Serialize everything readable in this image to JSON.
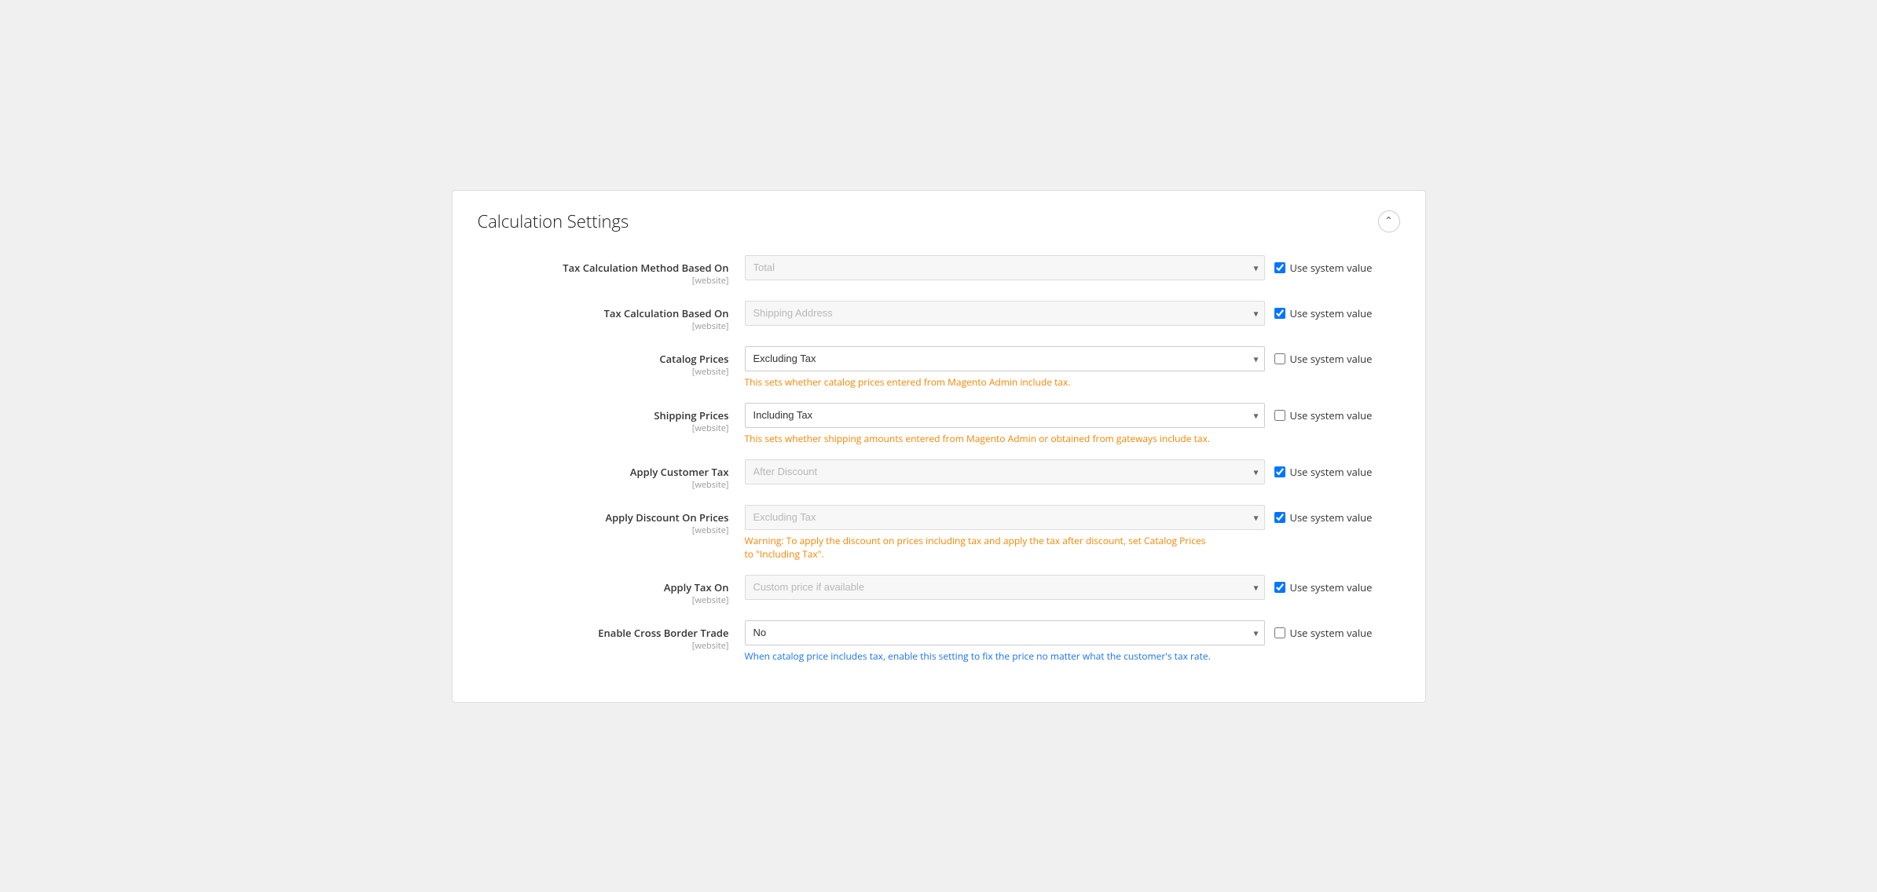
{
  "card": {
    "title": "Calculation Settings",
    "collapse_icon": "⌃"
  },
  "rows": [
    {
      "id": "tax-calc-method",
      "label": "Tax Calculation Method Based On",
      "scope": "[website]",
      "select_value": "Total",
      "select_placeholder": "Total",
      "disabled": true,
      "use_system": true,
      "hint": null,
      "warning": null,
      "info": null
    },
    {
      "id": "tax-calc-based-on",
      "label": "Tax Calculation Based On",
      "scope": "[website]",
      "select_value": "Shipping Address",
      "select_placeholder": "Shipping Address",
      "disabled": true,
      "use_system": true,
      "hint": null,
      "warning": null,
      "info": null
    },
    {
      "id": "catalog-prices",
      "label": "Catalog Prices",
      "scope": "[website]",
      "select_value": "Excluding Tax",
      "select_placeholder": "Excluding Tax",
      "disabled": false,
      "use_system": false,
      "hint": "This sets whether catalog prices entered from Magento Admin include tax.",
      "warning": null,
      "info": null
    },
    {
      "id": "shipping-prices",
      "label": "Shipping Prices",
      "scope": "[website]",
      "select_value": "Including Tax",
      "select_placeholder": "Including Tax",
      "disabled": false,
      "use_system": false,
      "hint": "This sets whether shipping amounts entered from Magento Admin or obtained from gateways include tax.",
      "warning": null,
      "info": null
    },
    {
      "id": "apply-customer-tax",
      "label": "Apply Customer Tax",
      "scope": "[website]",
      "select_value": "After Discount",
      "select_placeholder": "After Discount",
      "disabled": true,
      "use_system": true,
      "hint": null,
      "warning": null,
      "info": null
    },
    {
      "id": "apply-discount-on-prices",
      "label": "Apply Discount On Prices",
      "scope": "[website]",
      "select_value": "Excluding Tax",
      "select_placeholder": "Excluding Tax",
      "disabled": true,
      "use_system": true,
      "hint": null,
      "warning": "Warning: To apply the discount on prices including tax and apply the tax after discount, set Catalog Prices to \"Including Tax\".",
      "info": null
    },
    {
      "id": "apply-tax-on",
      "label": "Apply Tax On",
      "scope": "[website]",
      "select_value": "Custom price if available",
      "select_placeholder": "Custom price if available",
      "disabled": true,
      "use_system": true,
      "hint": null,
      "warning": null,
      "info": null
    },
    {
      "id": "enable-cross-border-trade",
      "label": "Enable Cross Border Trade",
      "scope": "[website]",
      "select_value": "No",
      "select_placeholder": "No",
      "disabled": false,
      "use_system": false,
      "hint": null,
      "warning": null,
      "info": "When catalog price includes tax, enable this setting to fix the price no matter what the customer's tax rate."
    }
  ]
}
